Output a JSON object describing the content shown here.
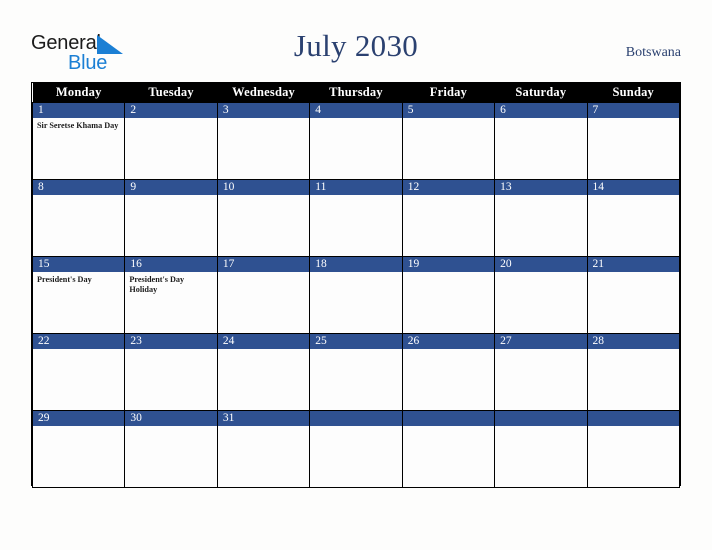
{
  "brand": {
    "name_part1": "General",
    "name_part2": "Blue",
    "triangle_color": "#1b7fd4"
  },
  "header": {
    "title": "July 2030",
    "region": "Botswana",
    "title_color": "#2b4170"
  },
  "calendar": {
    "month": "July",
    "year": "2030",
    "weekday_headers": [
      "Monday",
      "Tuesday",
      "Wednesday",
      "Thursday",
      "Friday",
      "Saturday",
      "Sunday"
    ],
    "header_bg": "#000000",
    "daynum_bg": "#2f5191",
    "cell_bg": "#fdfdfd",
    "border_color": "#000000",
    "weeks": [
      [
        {
          "day": "1",
          "events": [
            "Sir Seretse Khama Day"
          ]
        },
        {
          "day": "2",
          "events": []
        },
        {
          "day": "3",
          "events": []
        },
        {
          "day": "4",
          "events": []
        },
        {
          "day": "5",
          "events": []
        },
        {
          "day": "6",
          "events": []
        },
        {
          "day": "7",
          "events": []
        }
      ],
      [
        {
          "day": "8",
          "events": []
        },
        {
          "day": "9",
          "events": []
        },
        {
          "day": "10",
          "events": []
        },
        {
          "day": "11",
          "events": []
        },
        {
          "day": "12",
          "events": []
        },
        {
          "day": "13",
          "events": []
        },
        {
          "day": "14",
          "events": []
        }
      ],
      [
        {
          "day": "15",
          "events": [
            "President's Day"
          ]
        },
        {
          "day": "16",
          "events": [
            "President's Day Holiday"
          ]
        },
        {
          "day": "17",
          "events": []
        },
        {
          "day": "18",
          "events": []
        },
        {
          "day": "19",
          "events": []
        },
        {
          "day": "20",
          "events": []
        },
        {
          "day": "21",
          "events": []
        }
      ],
      [
        {
          "day": "22",
          "events": []
        },
        {
          "day": "23",
          "events": []
        },
        {
          "day": "24",
          "events": []
        },
        {
          "day": "25",
          "events": []
        },
        {
          "day": "26",
          "events": []
        },
        {
          "day": "27",
          "events": []
        },
        {
          "day": "28",
          "events": []
        }
      ],
      [
        {
          "day": "29",
          "events": []
        },
        {
          "day": "30",
          "events": []
        },
        {
          "day": "31",
          "events": []
        },
        {
          "day": "",
          "events": []
        },
        {
          "day": "",
          "events": []
        },
        {
          "day": "",
          "events": []
        },
        {
          "day": "",
          "events": []
        }
      ]
    ]
  }
}
